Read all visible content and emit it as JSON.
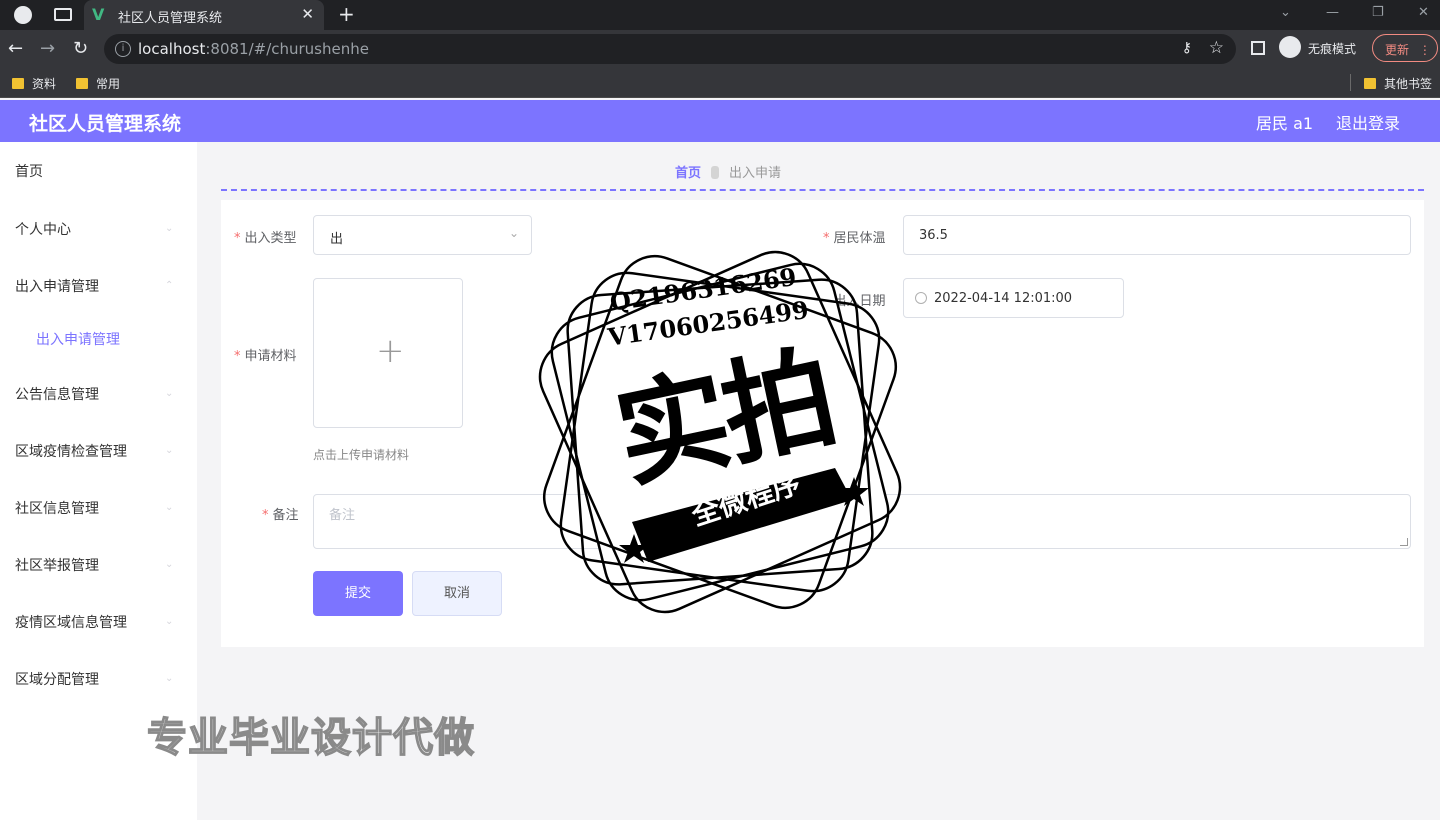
{
  "browser": {
    "tab_title": "社区人员管理系统",
    "url_host": "localhost",
    "url_rest": ":8081/#/churushenhe",
    "incognito_label": "无痕模式",
    "update_label": "更新",
    "bookmarks": [
      "资料",
      "常用"
    ],
    "other_bookmarks": "其他书签"
  },
  "header": {
    "title": "社区人员管理系统",
    "user": "居民 a1",
    "logout": "退出登录"
  },
  "sidebar": {
    "items": [
      "首页",
      "个人中心",
      "出入申请管理",
      "出入申请管理",
      "公告信息管理",
      "区域疫情检查管理",
      "社区信息管理",
      "社区举报管理",
      "疫情区域信息管理",
      "区域分配管理"
    ]
  },
  "breadcrumb": {
    "home": "首页",
    "current": "出入申请"
  },
  "form": {
    "type_label": "出入类型",
    "type_value": "出",
    "temp_label": "居民体温",
    "temp_value": "36.5",
    "date_label": "出入日期",
    "date_value": "2022-04-14 12:01:00",
    "material_label": "申请材料",
    "upload_tip": "点击上传申请材料",
    "remark_label": "备注",
    "remark_placeholder": "备注",
    "submit": "提交",
    "cancel": "取消"
  },
  "watermark": {
    "qq": "Q2196316269",
    "wechat": "V17060256499",
    "big": "实拍",
    "ribbon": "全微程序",
    "ad": "专业毕业设计代做"
  }
}
